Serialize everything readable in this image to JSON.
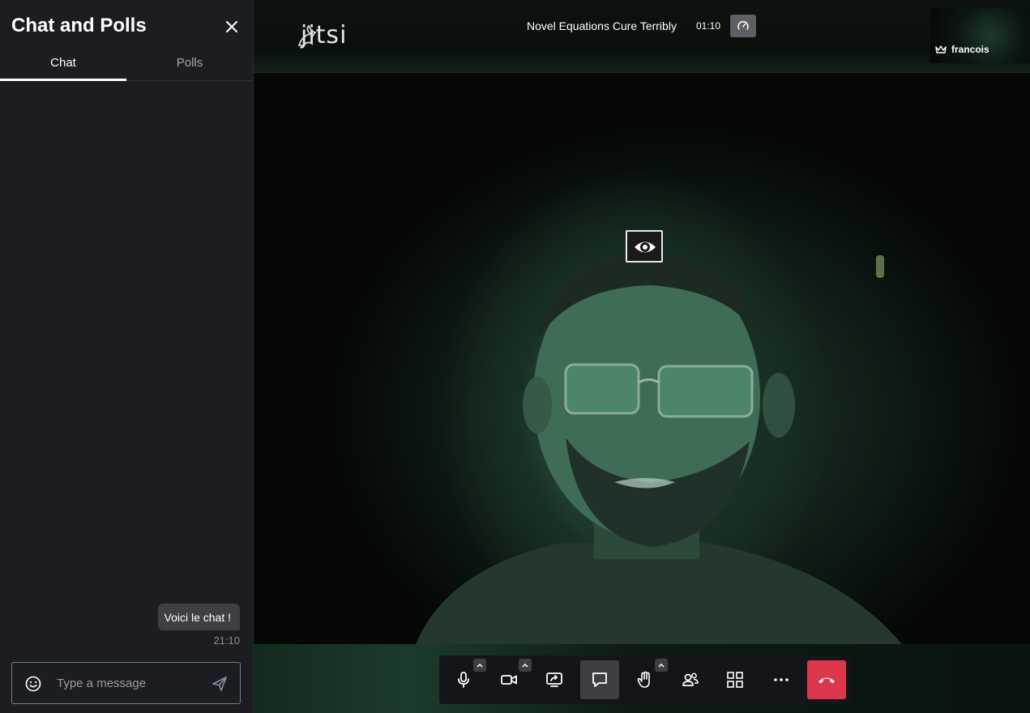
{
  "sidebar": {
    "title": "Chat and Polls",
    "close_icon": "close-icon",
    "tabs": [
      {
        "label": "Chat",
        "active": true
      },
      {
        "label": "Polls",
        "active": false
      }
    ],
    "messages": [
      {
        "text": "Voici le chat !",
        "time": "21:10"
      }
    ],
    "composer": {
      "placeholder": "Type a message",
      "emoji_icon": "smiley-icon",
      "send_icon": "send-icon"
    }
  },
  "header": {
    "logo_text": "jitsi",
    "conference_title": "Novel Equations Cure Terribly",
    "timer": "01:10",
    "connection_icon": "gauge-icon"
  },
  "thumbnail": {
    "participant_name": "francois",
    "moderator_icon": "crown-icon"
  },
  "toolbar": {
    "buttons": [
      {
        "icon": "microphone-icon",
        "has_menu": true
      },
      {
        "icon": "camera-icon",
        "has_menu": true
      },
      {
        "icon": "screen-share-icon",
        "has_menu": false
      },
      {
        "icon": "chat-icon",
        "active": true
      },
      {
        "icon": "raise-hand-icon",
        "has_menu": true
      },
      {
        "icon": "participants-icon"
      },
      {
        "icon": "tile-view-icon"
      },
      {
        "icon": "more-options-icon"
      },
      {
        "icon": "hangup-icon"
      }
    ],
    "hangup_color": "#dd374e"
  },
  "colors": {
    "sidebar_bg": "#1b1d22",
    "accent_active": "#3d3f44"
  }
}
